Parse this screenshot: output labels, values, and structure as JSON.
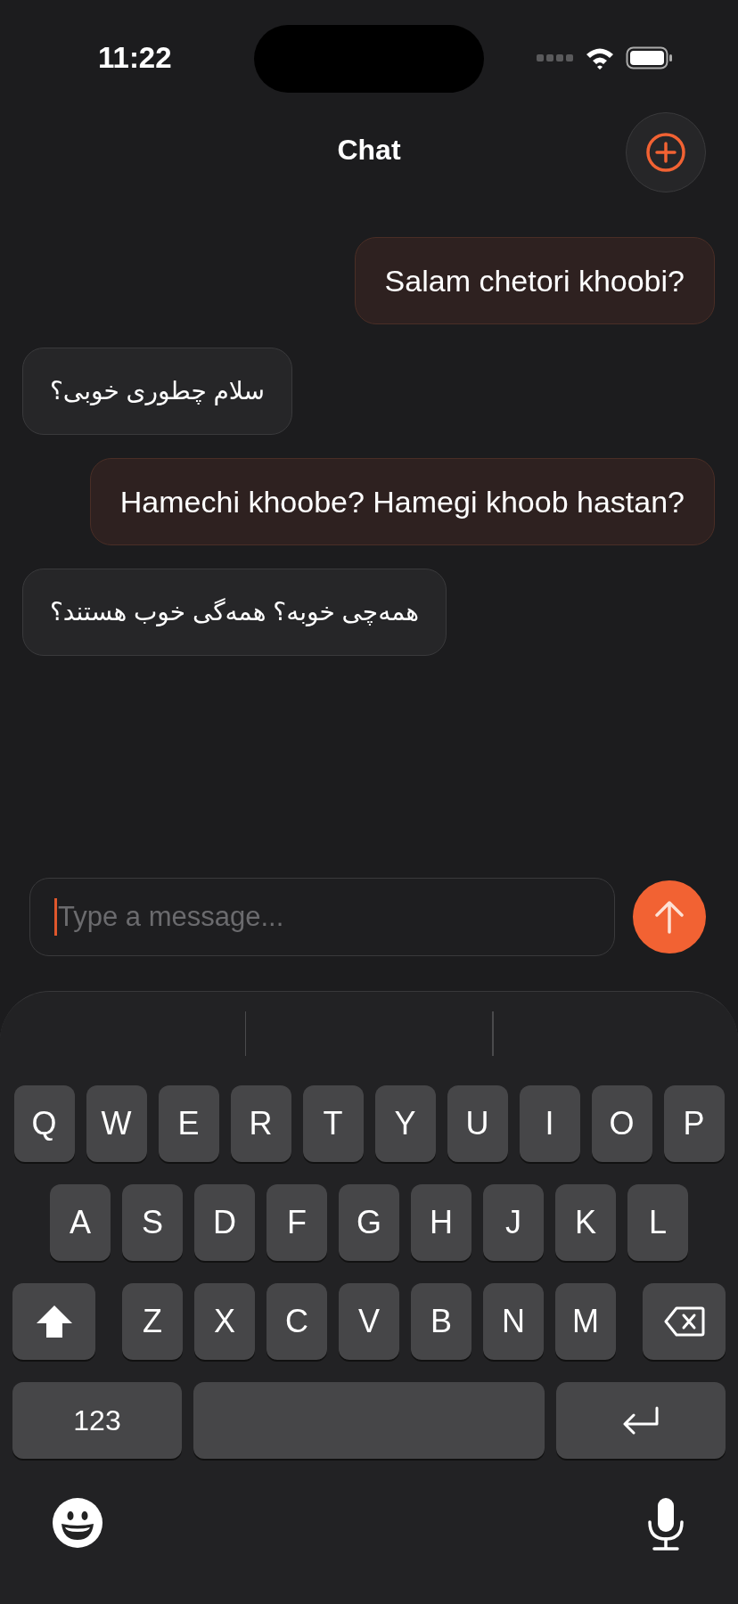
{
  "status_bar": {
    "time": "11:22"
  },
  "header": {
    "title": "Chat"
  },
  "messages": [
    {
      "kind": "sent",
      "text": "Salam chetori khoobi?"
    },
    {
      "kind": "received",
      "text": "سلام چطوری خوبی؟"
    },
    {
      "kind": "sent",
      "text": "Hamechi khoobe? Hamegi khoob hastan?"
    },
    {
      "kind": "received",
      "text": "همه‌چی خوبه؟ همه‌گی خوب هستند؟"
    }
  ],
  "composer": {
    "placeholder": "Type a message..."
  },
  "keyboard": {
    "rows": [
      [
        {
          "kind": "letter",
          "label": "Q"
        },
        {
          "kind": "letter",
          "label": "W"
        },
        {
          "kind": "letter",
          "label": "E"
        },
        {
          "kind": "letter",
          "label": "R"
        },
        {
          "kind": "letter",
          "label": "T"
        },
        {
          "kind": "letter",
          "label": "Y"
        },
        {
          "kind": "letter",
          "label": "U"
        },
        {
          "kind": "letter",
          "label": "I"
        },
        {
          "kind": "letter",
          "label": "O"
        },
        {
          "kind": "letter",
          "label": "P"
        }
      ],
      [
        {
          "kind": "letter",
          "label": "A"
        },
        {
          "kind": "letter",
          "label": "S"
        },
        {
          "kind": "letter",
          "label": "D"
        },
        {
          "kind": "letter",
          "label": "F"
        },
        {
          "kind": "letter",
          "label": "G"
        },
        {
          "kind": "letter",
          "label": "H"
        },
        {
          "kind": "letter",
          "label": "J"
        },
        {
          "kind": "letter",
          "label": "K"
        },
        {
          "kind": "letter",
          "label": "L"
        }
      ],
      [
        {
          "kind": "shift"
        },
        {
          "kind": "letter",
          "label": "Z"
        },
        {
          "kind": "letter",
          "label": "X"
        },
        {
          "kind": "letter",
          "label": "C"
        },
        {
          "kind": "letter",
          "label": "V"
        },
        {
          "kind": "letter",
          "label": "B"
        },
        {
          "kind": "letter",
          "label": "N"
        },
        {
          "kind": "letter",
          "label": "M"
        },
        {
          "kind": "delete"
        }
      ],
      [
        {
          "kind": "mode",
          "label": "123"
        },
        {
          "kind": "space"
        },
        {
          "kind": "return"
        }
      ]
    ]
  }
}
